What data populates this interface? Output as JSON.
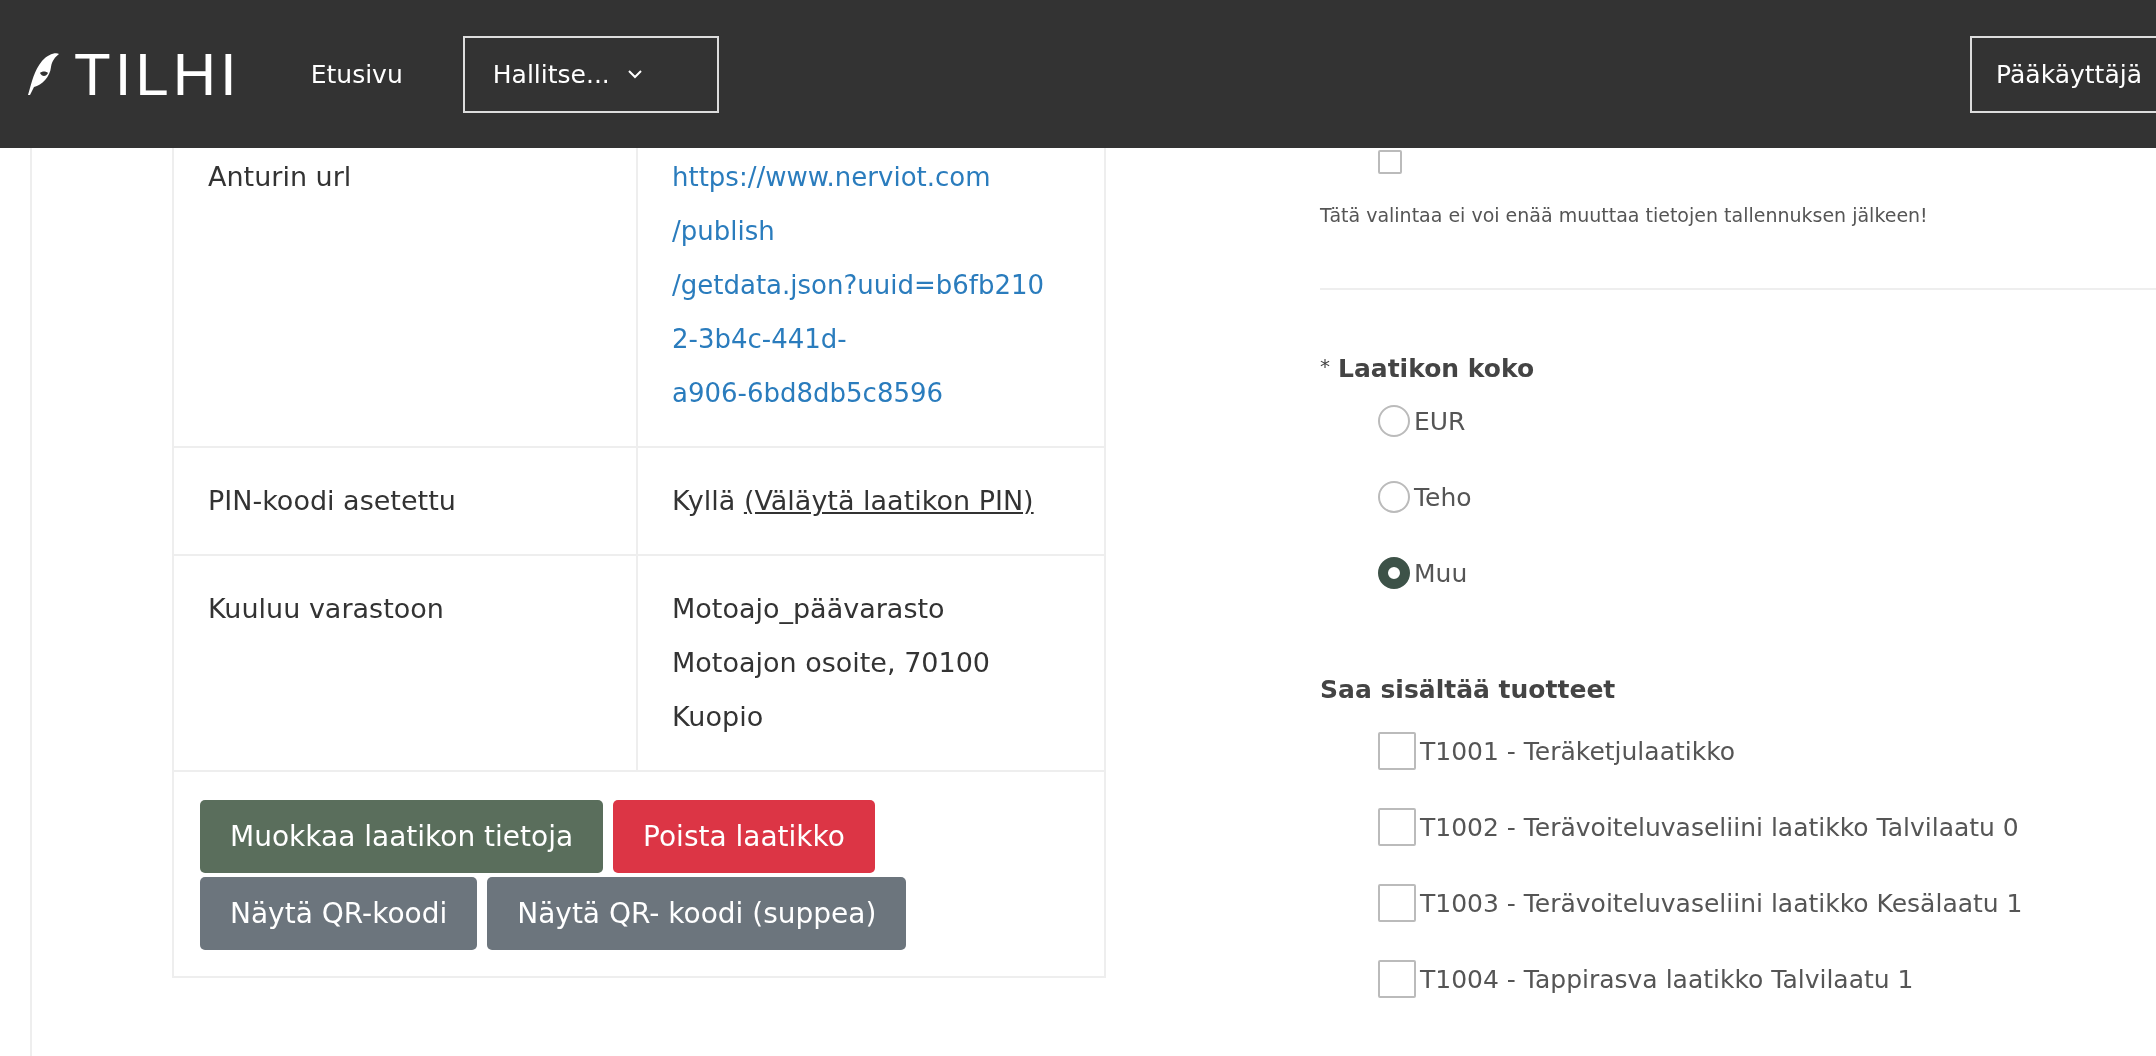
{
  "header": {
    "logo": "TILHI",
    "nav": [
      {
        "label": "Etusivu",
        "kind": "link"
      },
      {
        "label": "Hallitse...",
        "kind": "dropdown"
      }
    ],
    "user_button": "Pääkäyttäjä"
  },
  "details": {
    "rows": [
      {
        "label": "Anturin url",
        "kind": "link",
        "lines": [
          "https://www.nerviot.com",
          "/publish",
          "/getdata.json?uuid=b6fb210",
          "2-3b4c-441d-",
          "a906-6bd8db5c8596"
        ]
      },
      {
        "label": "PIN-koodi asetettu",
        "kind": "pin",
        "value": "Kyllä",
        "link": "(Väläytä laatikon PIN)"
      },
      {
        "label": "Kuuluu varastoon",
        "kind": "lines",
        "lines": [
          "Motoajo_päävarasto",
          "Motoajon osoite, 70100",
          "Kuopio"
        ]
      }
    ],
    "buttons": [
      {
        "label": "Muokkaa laatikon tietoja",
        "kind": "success"
      },
      {
        "label": "Poista laatikko",
        "kind": "danger"
      },
      {
        "label": "Näytä QR-koodi",
        "kind": "secondary"
      },
      {
        "label": "Näytä QR- koodi (suppea)",
        "kind": "secondary"
      }
    ]
  },
  "form": {
    "top_checkbox": {
      "checked": false
    },
    "help_text": "Tätä valintaa ei voi enää muuttaa tietojen tallennuksen jälkeen!",
    "size_group": {
      "required_mark": "*",
      "label": "Laatikon koko",
      "options": [
        {
          "label": "EUR",
          "selected": false
        },
        {
          "label": "Teho",
          "selected": false
        },
        {
          "label": "Muu",
          "selected": true
        }
      ]
    },
    "products": {
      "label": "Saa sisältää tuotteet",
      "items": [
        {
          "label": "T1001 - Teräketjulaatikko",
          "checked": false
        },
        {
          "label": "T1002 - Terävoiteluvaseliini laatikko Talvilaatu 0",
          "checked": false
        },
        {
          "label": "T1003 - Terävoiteluvaseliini laatikko Kesälaatu 1",
          "checked": false
        },
        {
          "label": "T1004 - Tappirasva laatikko Talvilaatu 1",
          "checked": false
        }
      ]
    }
  }
}
